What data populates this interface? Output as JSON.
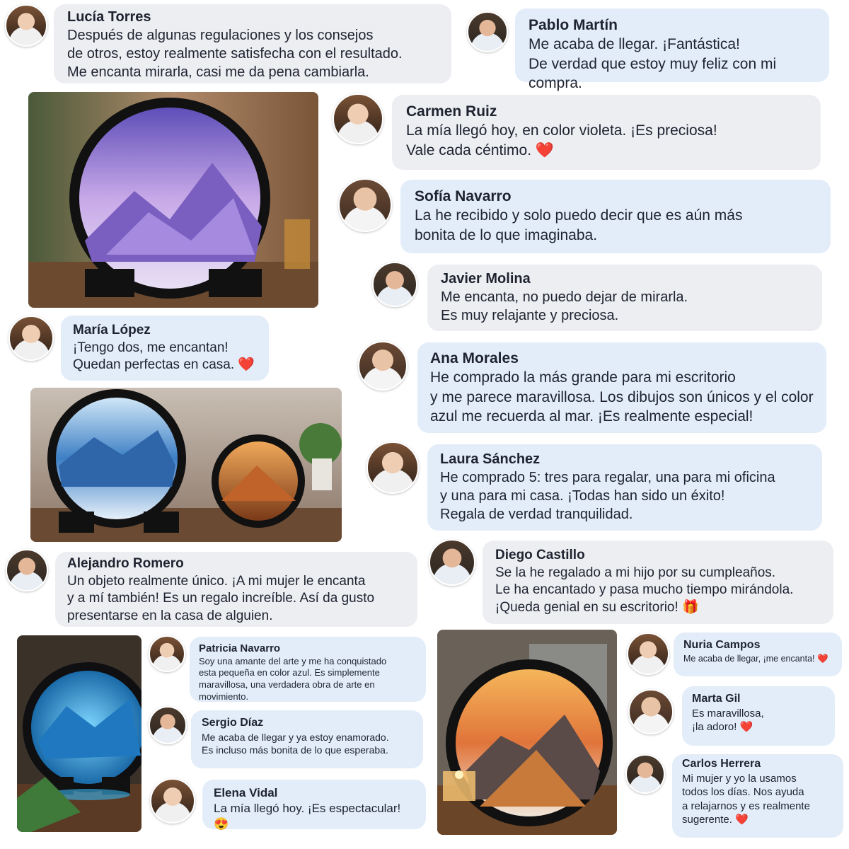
{
  "reviews": [
    {
      "name": "Lucía Torres",
      "text": "Después de algunas regulaciones y los consejos\nde otros, estoy realmente satisfecha con el resultado.\nMe encanta mirarla, casi me da pena cambiarla."
    },
    {
      "name": "Pablo Martín",
      "text": "Me acaba de llegar. ¡Fantástica!\nDe verdad que estoy muy feliz con mi compra."
    },
    {
      "name": "Carmen Ruiz",
      "text": "La mía llegó hoy, en color violeta. ¡Es preciosa!\nVale cada céntimo. ❤️"
    },
    {
      "name": "Sofía Navarro",
      "text": "La he recibido y solo puedo decir que es aún más\nbonita de lo que imaginaba."
    },
    {
      "name": "Javier Molina",
      "text": "Me encanta, no puedo dejar de mirarla.\nEs muy relajante y preciosa."
    },
    {
      "name": "María López",
      "text": "¡Tengo dos, me encantan!\nQuedan perfectas en casa. ❤️"
    },
    {
      "name": "Ana Morales",
      "text": "He comprado la más grande para mi escritorio\ny me parece maravillosa. Los dibujos son únicos y el color\nazul me recuerda al mar. ¡Es realmente especial!"
    },
    {
      "name": "Laura Sánchez",
      "text": "He comprado 5: tres para regalar, una para mi oficina\ny una para mi casa. ¡Todas han sido un éxito!\nRegala de verdad tranquilidad."
    },
    {
      "name": "Alejandro Romero",
      "text": "Un objeto realmente único. ¡A mi mujer le encanta\ny a mí también! Es un regalo increíble. Así da gusto\npresentarse en la casa de alguien."
    },
    {
      "name": "Diego Castillo",
      "text": "Se la he regalado a mi hijo por su cumpleaños.\nLe ha encantado y pasa mucho tiempo mirándola.\n¡Queda genial en su escritorio! 🎁"
    },
    {
      "name": "Patricia Navarro",
      "text": "Soy una amante del arte y me ha conquistado\nesta pequeña en color azul. Es simplemente\nmaravillosa, una verdadera obra de arte en movimiento."
    },
    {
      "name": "Sergio Díaz",
      "text": "Me acaba de llegar y ya estoy enamorado.\nEs incluso más bonita de lo que esperaba."
    },
    {
      "name": "Elena Vidal",
      "text": "La mía llegó hoy. ¡Es espectacular! 😍"
    },
    {
      "name": "Nuria Campos",
      "text": "Me acaba de llegar, ¡me encanta! ❤️"
    },
    {
      "name": "Marta Gil",
      "text": "Es maravillosa,\n¡la adoro! ❤️"
    },
    {
      "name": "Carlos Herrera",
      "text": "Mi mujer y yo la usamos\ntodos los días. Nos ayuda\na relajarnos y es realmente\nsugerente. ❤️"
    }
  ],
  "colors": {
    "bubble_gray": "#eceef2",
    "bubble_blue": "#e2edf9",
    "text": "#1f2330"
  },
  "photos": [
    "purple-sand-art-frame-photo",
    "blue-and-orange-sand-art-frames-photo",
    "glowing-blue-sand-art-frame-photo",
    "sunset-sand-art-frame-photo"
  ]
}
